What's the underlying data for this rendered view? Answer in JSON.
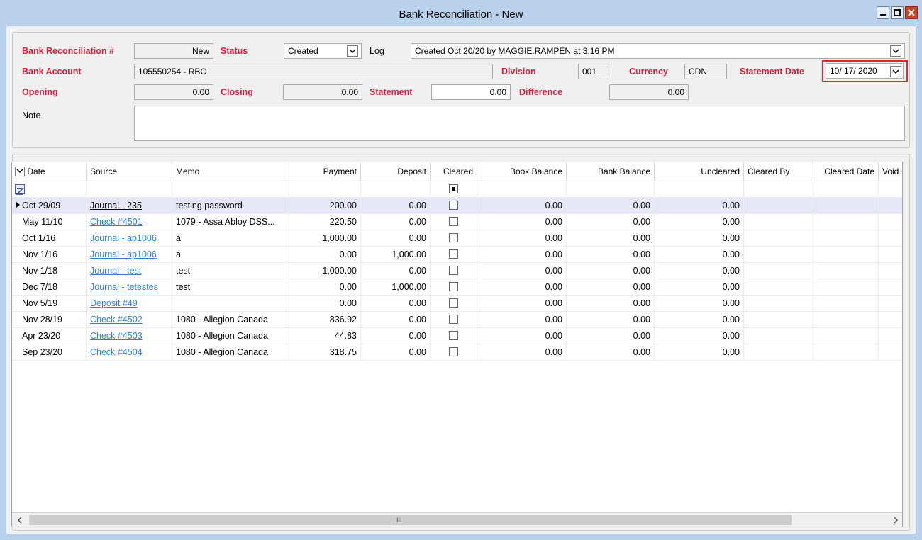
{
  "window": {
    "title": "Bank Reconciliation - New"
  },
  "header": {
    "rec_no_label": "Bank Reconciliation #",
    "rec_no_value": "New",
    "status_label": "Status",
    "status_value": "Created",
    "log_label": "Log",
    "log_value": "Created Oct 20/20 by MAGGIE.RAMPEN at 3:16 PM",
    "bank_account_label": "Bank Account",
    "bank_account_value": "105550254 - RBC",
    "division_label": "Division",
    "division_value": "001",
    "currency_label": "Currency",
    "currency_value": "CDN",
    "statement_date_label": "Statement Date",
    "statement_date_value": "10/ 17/ 2020",
    "opening_label": "Opening",
    "opening_value": "0.00",
    "closing_label": "Closing",
    "closing_value": "0.00",
    "statement_label": "Statement",
    "statement_value": "0.00",
    "difference_label": "Difference",
    "difference_value": "0.00",
    "note_label": "Note",
    "note_value": ""
  },
  "grid": {
    "columns": [
      "Date",
      "Source",
      "Memo",
      "Payment",
      "Deposit",
      "Cleared",
      "Book Balance",
      "Bank Balance",
      "Uncleared",
      "Cleared By",
      "Cleared Date",
      "Void"
    ],
    "rows": [
      {
        "date": "Oct 29/09",
        "source": "Journal - 235",
        "memo": "testing password",
        "payment": "200.00",
        "deposit": "0.00",
        "book": "0.00",
        "bank": "0.00",
        "uncleared": "0.00"
      },
      {
        "date": "May 11/10",
        "source": "Check #4501",
        "memo": "1079 - Assa Abloy DSS...",
        "payment": "220.50",
        "deposit": "0.00",
        "book": "0.00",
        "bank": "0.00",
        "uncleared": "0.00"
      },
      {
        "date": "Oct 1/16",
        "source": "Journal - ap1006",
        "memo": "a",
        "payment": "1,000.00",
        "deposit": "0.00",
        "book": "0.00",
        "bank": "0.00",
        "uncleared": "0.00"
      },
      {
        "date": "Nov 1/16",
        "source": "Journal - ap1006",
        "memo": "a",
        "payment": "0.00",
        "deposit": "1,000.00",
        "book": "0.00",
        "bank": "0.00",
        "uncleared": "0.00"
      },
      {
        "date": "Nov 1/18",
        "source": "Journal - test",
        "memo": "test",
        "payment": "1,000.00",
        "deposit": "0.00",
        "book": "0.00",
        "bank": "0.00",
        "uncleared": "0.00"
      },
      {
        "date": "Dec 7/18",
        "source": "Journal - tetestes",
        "memo": "test",
        "payment": "0.00",
        "deposit": "1,000.00",
        "book": "0.00",
        "bank": "0.00",
        "uncleared": "0.00"
      },
      {
        "date": "Nov 5/19",
        "source": "Deposit #49",
        "memo": "",
        "payment": "0.00",
        "deposit": "0.00",
        "book": "0.00",
        "bank": "0.00",
        "uncleared": "0.00"
      },
      {
        "date": "Nov 28/19",
        "source": "Check #4502",
        "memo": "1080 - Allegion Canada",
        "payment": "836.92",
        "deposit": "0.00",
        "book": "0.00",
        "bank": "0.00",
        "uncleared": "0.00"
      },
      {
        "date": "Apr 23/20",
        "source": "Check #4503",
        "memo": "1080 - Allegion Canada",
        "payment": "44.83",
        "deposit": "0.00",
        "book": "0.00",
        "bank": "0.00",
        "uncleared": "0.00"
      },
      {
        "date": "Sep 23/20",
        "source": "Check #4504",
        "memo": "1080 - Allegion Canada",
        "payment": "318.75",
        "deposit": "0.00",
        "book": "0.00",
        "bank": "0.00",
        "uncleared": "0.00"
      }
    ],
    "scroll_thumb_glyph": "III"
  },
  "colors": {
    "label_red": "#d21f3c",
    "link_blue": "#2f7fd8",
    "highlight_border": "#e0282e"
  }
}
